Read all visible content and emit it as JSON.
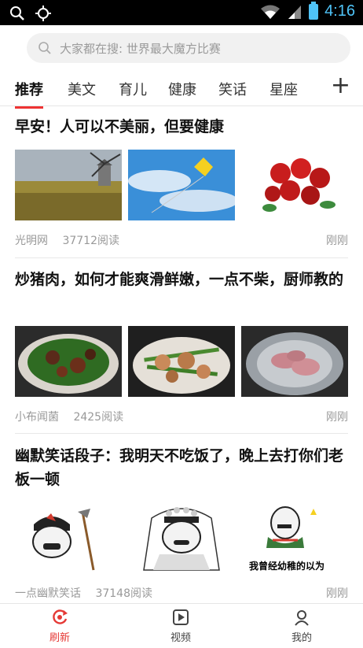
{
  "status": {
    "time": "4:16",
    "icons": [
      "search-icon",
      "location-icon",
      "wifi-icon",
      "signal-icon",
      "battery-icon"
    ]
  },
  "search": {
    "placeholder": "大家都在搜: 世界最大魔方比赛"
  },
  "tabs": [
    {
      "label": "推荐",
      "active": true
    },
    {
      "label": "美文"
    },
    {
      "label": "育儿"
    },
    {
      "label": "健康"
    },
    {
      "label": "笑话"
    },
    {
      "label": "星座"
    }
  ],
  "tabs_more": "+",
  "articles": [
    {
      "title": "早安！人可以不美丽，但要健康",
      "source": "光明网",
      "reads": "37712阅读",
      "time": "刚刚",
      "images": [
        "windmill-field",
        "kite-sky",
        "red-roses"
      ]
    },
    {
      "title": "炒猪肉，如何才能爽滑鲜嫩，一点不柴，厨师教的",
      "source": "小布闻菌",
      "reads": "2425阅读",
      "time": "刚刚",
      "images": [
        "pepper-pork-dish",
        "green-bean-pork",
        "raw-pork-bowl"
      ]
    },
    {
      "title": "幽默笑话段子：我明天不吃饭了，晚上去打你们老板一顿",
      "source": "一点幽默笑话",
      "reads": "37148阅读",
      "time": "刚刚",
      "images": [
        "meme-soldier",
        "meme-bride",
        "meme-caption"
      ],
      "meme_caption": "我曾经幼稚的以为"
    }
  ],
  "nav": [
    {
      "label": "刷新",
      "icon": "refresh-icon",
      "active": true
    },
    {
      "label": "视频",
      "icon": "video-icon"
    },
    {
      "label": "我的",
      "icon": "profile-icon"
    }
  ],
  "colors": {
    "accent": "#e53935",
    "status_accent": "#4fc3f7"
  }
}
